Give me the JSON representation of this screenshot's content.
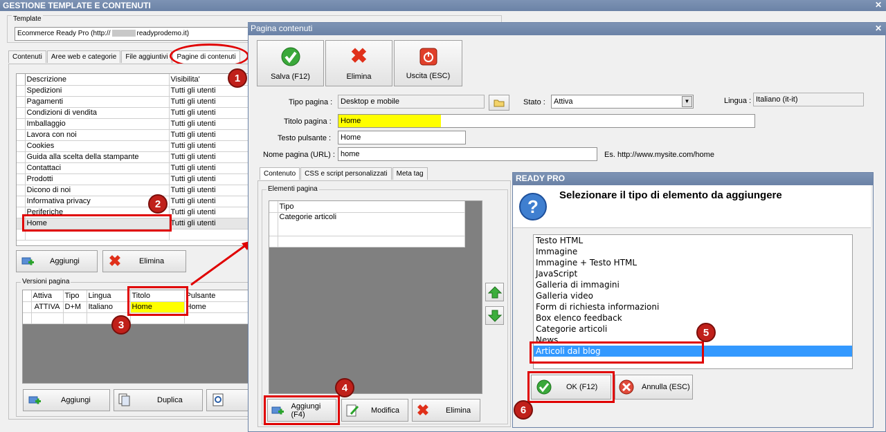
{
  "main_window": {
    "title": "GESTIONE TEMPLATE E CONTENUTI"
  },
  "template": {
    "group_label": "Template",
    "value": "Ecommerce Ready Pro (http://",
    "value_tail": "readyprodemo.it)"
  },
  "left_tabs": [
    "Contenuti",
    "Aree web e categorie",
    "File aggiuntivi",
    "Pagine di contenuti"
  ],
  "pages_table": {
    "headers": [
      "Descrizione",
      "Visibilita'"
    ],
    "rows": [
      [
        "Spedizioni",
        "Tutti gli utenti"
      ],
      [
        "Pagamenti",
        "Tutti gli utenti"
      ],
      [
        "Condizioni di vendita",
        "Tutti gli utenti"
      ],
      [
        "Imballaggio",
        "Tutti gli utenti"
      ],
      [
        "Lavora con noi",
        "Tutti gli utenti"
      ],
      [
        "Cookies",
        "Tutti gli utenti"
      ],
      [
        "Guida alla scelta della stampante",
        "Tutti gli utenti"
      ],
      [
        "Contattaci",
        "Tutti gli utenti"
      ],
      [
        "Prodotti",
        "Tutti gli utenti"
      ],
      [
        "Dicono di noi",
        "Tutti gli utenti"
      ],
      [
        "Informativa privacy",
        "Tutti gli utenti"
      ],
      [
        "Periferiche",
        "Tutti gli utenti"
      ],
      [
        "Home",
        "Tutti gli utenti"
      ]
    ]
  },
  "left_buttons": {
    "add": "Aggiungi",
    "delete": "Elimina"
  },
  "versions": {
    "group_label": "Versioni pagina",
    "headers": [
      "Attiva",
      "Tipo",
      "Lingua",
      "Titolo",
      "Pulsante"
    ],
    "row": [
      "ATTIVA",
      "D+M",
      "Italiano",
      "Home",
      "Home"
    ]
  },
  "version_buttons": {
    "add": "Aggiungi",
    "duplicate": "Duplica"
  },
  "dialog": {
    "title": "Pagina contenuti",
    "toolbar": {
      "save": "Salva (F12)",
      "delete": "Elimina",
      "exit": "Uscita (ESC)"
    },
    "tipo_label": "Tipo pagina :",
    "tipo_value": "Desktop e mobile",
    "stato_label": "Stato :",
    "stato_value": "Attiva",
    "lingua_label": "Lingua :",
    "lingua_value": "Italiano (it-it)",
    "titolo_label": "Titolo pagina :",
    "titolo_value": "Home",
    "testo_label": "Testo pulsante :",
    "testo_value": "Home",
    "nome_label": "Nome pagina (URL) :",
    "nome_value": "home",
    "nome_example": "Es. http://www.mysite.com/home",
    "tabs": [
      "Contenuto",
      "CSS e script personalizzati",
      "Meta tag"
    ],
    "elements_label": "Elementi pagina",
    "elements_header": "Tipo",
    "elements_rows": [
      "Categorie articoli"
    ],
    "buttons": {
      "add": "Aggiungi (F4)",
      "edit": "Modifica",
      "delete": "Elimina"
    }
  },
  "popup": {
    "title": "READY PRO",
    "question": "Selezionare il tipo di elemento da aggiungere",
    "options": [
      "Testo HTML",
      "Immagine",
      "Immagine + Testo HTML",
      "JavaScript",
      "Galleria di immagini",
      "Galleria video",
      "Form di richiesta informazioni",
      "Box elenco feedback",
      "Categorie articoli",
      "News",
      "Articoli dal blog"
    ],
    "selected": "Articoli dal blog",
    "ok": "OK (F12)",
    "cancel": "Annulla (ESC)"
  },
  "badges": [
    "1",
    "2",
    "3",
    "4",
    "5",
    "6"
  ],
  "colors": {
    "titlebar": "#6b82a6",
    "highlight_yellow": "#ffff00",
    "selection": "#3399ff",
    "annotation_red": "#e00000"
  }
}
